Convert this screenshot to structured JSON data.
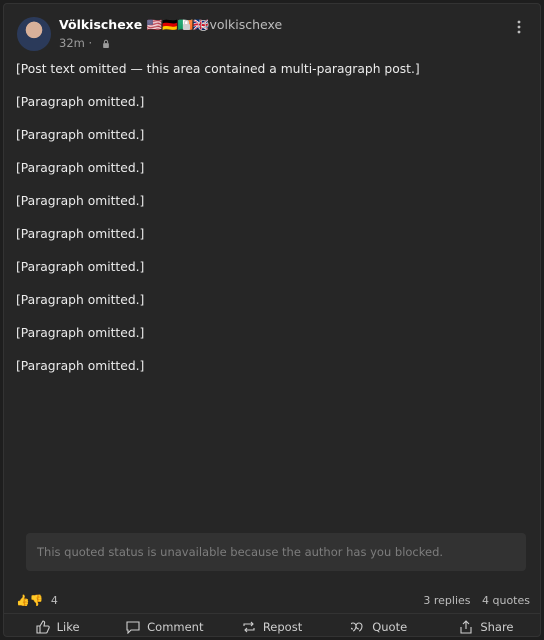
{
  "post": {
    "display_name": "Völkischexe 🇺🇸🇩🇪🇮🇪🇬🇧",
    "handle": "@volkischexe",
    "time": "32m ·",
    "paragraphs": [
      "[Post text omitted — this area contained a multi-paragraph post.]",
      "[Paragraph omitted.]",
      "[Paragraph omitted.]",
      "[Paragraph omitted.]",
      "[Paragraph omitted.]",
      "[Paragraph omitted.]",
      "[Paragraph omitted.]",
      "[Paragraph omitted.]",
      "[Paragraph omitted.]",
      "[Paragraph omitted.]"
    ],
    "quoted_status": "This quoted status is unavailable because the author has you blocked."
  },
  "stats": {
    "reaction_emojis": "👍👎",
    "reaction_count": "4",
    "replies": "3 replies",
    "quotes": "4 quotes"
  },
  "actions": {
    "like": "Like",
    "comment": "Comment",
    "repost": "Repost",
    "quote": "Quote",
    "share": "Share"
  },
  "icons": {
    "more": "more-vertical-icon",
    "lock": "lock-icon"
  }
}
